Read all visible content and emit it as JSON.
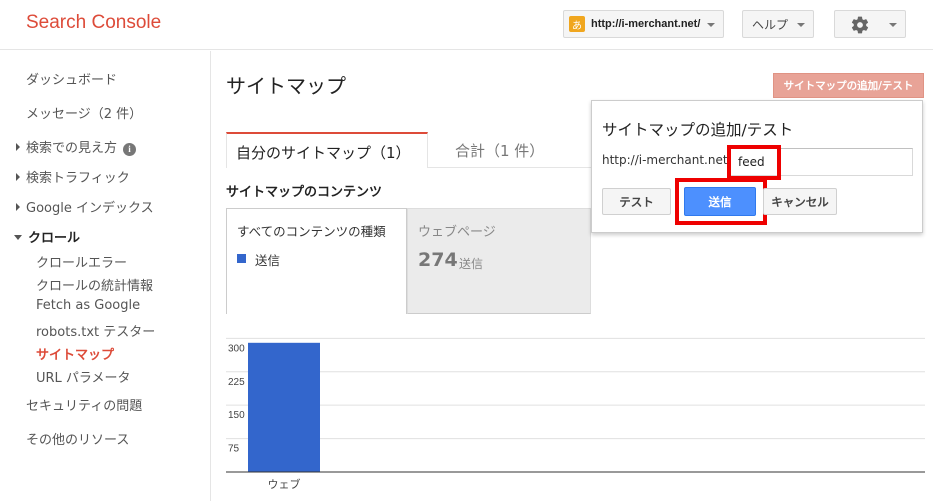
{
  "header": {
    "logo": "Search Console",
    "site_favicon": "あ",
    "site_url": "http://i-merchant.net/",
    "help_label": "ヘルプ",
    "settings_icon": "gear-icon"
  },
  "sidebar": {
    "items": [
      {
        "label": "ダッシュボード"
      },
      {
        "label": "メッセージ（2 件）"
      },
      {
        "label": "検索での見え方"
      },
      {
        "label": "検索トラフィック"
      },
      {
        "label": "Google インデックス"
      },
      {
        "label": "クロール"
      },
      {
        "label": "クロールエラー"
      },
      {
        "label": "クロールの統計情報"
      },
      {
        "label": "Fetch as Google"
      },
      {
        "label": "robots.txt テスター"
      },
      {
        "label": "サイトマップ"
      },
      {
        "label": "URL パラメータ"
      },
      {
        "label": "セキュリティの問題"
      },
      {
        "label": "その他のリソース"
      }
    ],
    "info_glyph": "i"
  },
  "main": {
    "page_title": "サイトマップ",
    "add_test_button": "サイトマップの追加/テスト",
    "tabs": [
      {
        "label": "自分のサイトマップ（1）"
      },
      {
        "label": "合計（1 件）"
      }
    ],
    "section_title": "サイトマップのコンテンツ",
    "card_all": {
      "title": "すべてのコンテンツの種類",
      "legend_label": "送信"
    },
    "card_web": {
      "title": "ウェブページ",
      "count": "274",
      "unit": "送信"
    }
  },
  "popup": {
    "title": "サイトマップの追加/テスト",
    "url_prefix": "http://i-merchant.net/",
    "input_value": "feed",
    "test_button": "テスト",
    "send_button": "送信",
    "cancel_button": "キャンセル"
  },
  "colors": {
    "brand_red": "#dd4b39",
    "bar_blue": "#3366cc",
    "highlight_red": "#ee0000",
    "action_blue": "#4d90fe"
  },
  "chart_data": {
    "type": "bar",
    "categories": [
      "ウェブ"
    ],
    "series": [
      {
        "values": [
          290
        ]
      }
    ],
    "yticks": [
      300,
      225,
      150,
      75
    ],
    "ylim": [
      0,
      312
    ],
    "grid": true
  }
}
